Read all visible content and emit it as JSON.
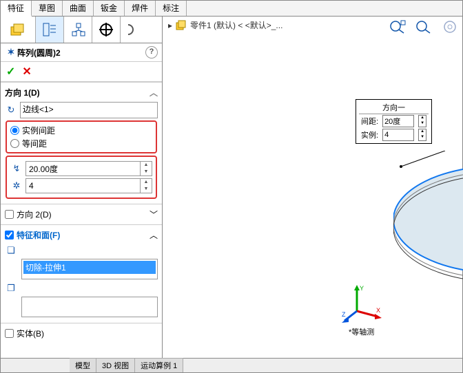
{
  "tabs": {
    "t1": "特征",
    "t2": "草图",
    "t3": "曲面",
    "t4": "钣金",
    "t5": "焊件",
    "t6": "标注"
  },
  "hdr": {
    "title": "阵列(圆周)2",
    "help": "?"
  },
  "ok": "✓",
  "cancel": "✕",
  "dir1": {
    "title": "方向 1(D)",
    "chev": "︿",
    "edge": "边线<1>",
    "r1": "实例间距",
    "r2": "等间距",
    "angle": "20.00度",
    "count": "4"
  },
  "dir2": {
    "title": "方向 2(D)",
    "chev": "﹀"
  },
  "feat": {
    "title": "特征和面(F)",
    "chev": "︿",
    "item": "切除-拉伸1"
  },
  "solid": {
    "title": "实体(B)"
  },
  "bc": {
    "arrow": "▸",
    "part": "零件1 (默认) < <默认>_..."
  },
  "callout": {
    "title": "方向一",
    "spacingLabel": "间距:",
    "spacing": "20度",
    "instLabel": "实例:",
    "inst": "4"
  },
  "axis": "*等轴测",
  "btabs": {
    "b1": "模型",
    "b2": "3D 视图",
    "b3": "运动算例 1"
  }
}
